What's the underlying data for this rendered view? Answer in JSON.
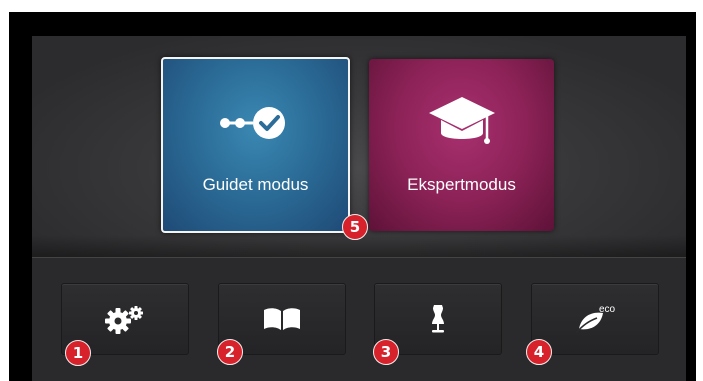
{
  "modes": {
    "guided_label": "Guidet modus",
    "expert_label": "Ekspertmodus"
  },
  "badges": {
    "b1": "1",
    "b2": "2",
    "b3": "3",
    "b4": "4",
    "b5": "5"
  },
  "toolbar": {
    "eco_text": "eco",
    "icons": [
      "gears-icon",
      "book-icon",
      "dress-form-icon",
      "eco-leaf-icon"
    ]
  },
  "colors": {
    "guided_tile": "#2b6d98",
    "expert_tile": "#8c2257",
    "badge": "#d8222b"
  }
}
